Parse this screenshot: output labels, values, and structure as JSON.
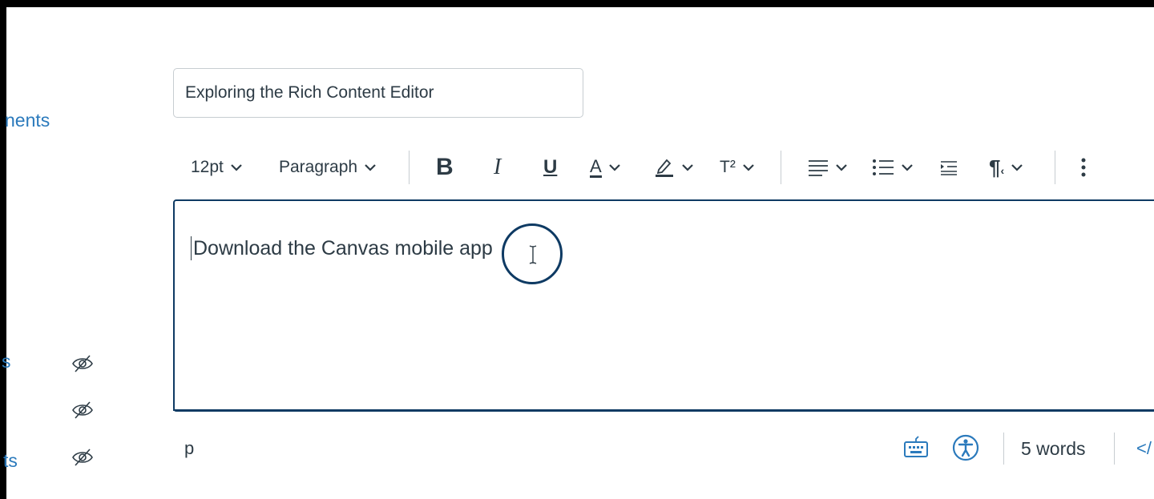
{
  "nav": {
    "fragments": [
      "nents",
      "s",
      "ts"
    ]
  },
  "title_input": {
    "value": "Exploring the Rich Content Editor"
  },
  "toolbar": {
    "font_size": "12pt",
    "block_format": "Paragraph",
    "bold": "B",
    "italic": "I",
    "underline": "U",
    "text_color": "A",
    "superscript": "T²"
  },
  "editor": {
    "content": "Download the Canvas mobile app"
  },
  "status_bar": {
    "path": "p",
    "word_count": "5 words",
    "html_toggle": "</"
  },
  "colors": {
    "link": "#2b7abc",
    "focus_border": "#0e3a63",
    "text": "#2d3b45",
    "border": "#c7cdd1"
  }
}
